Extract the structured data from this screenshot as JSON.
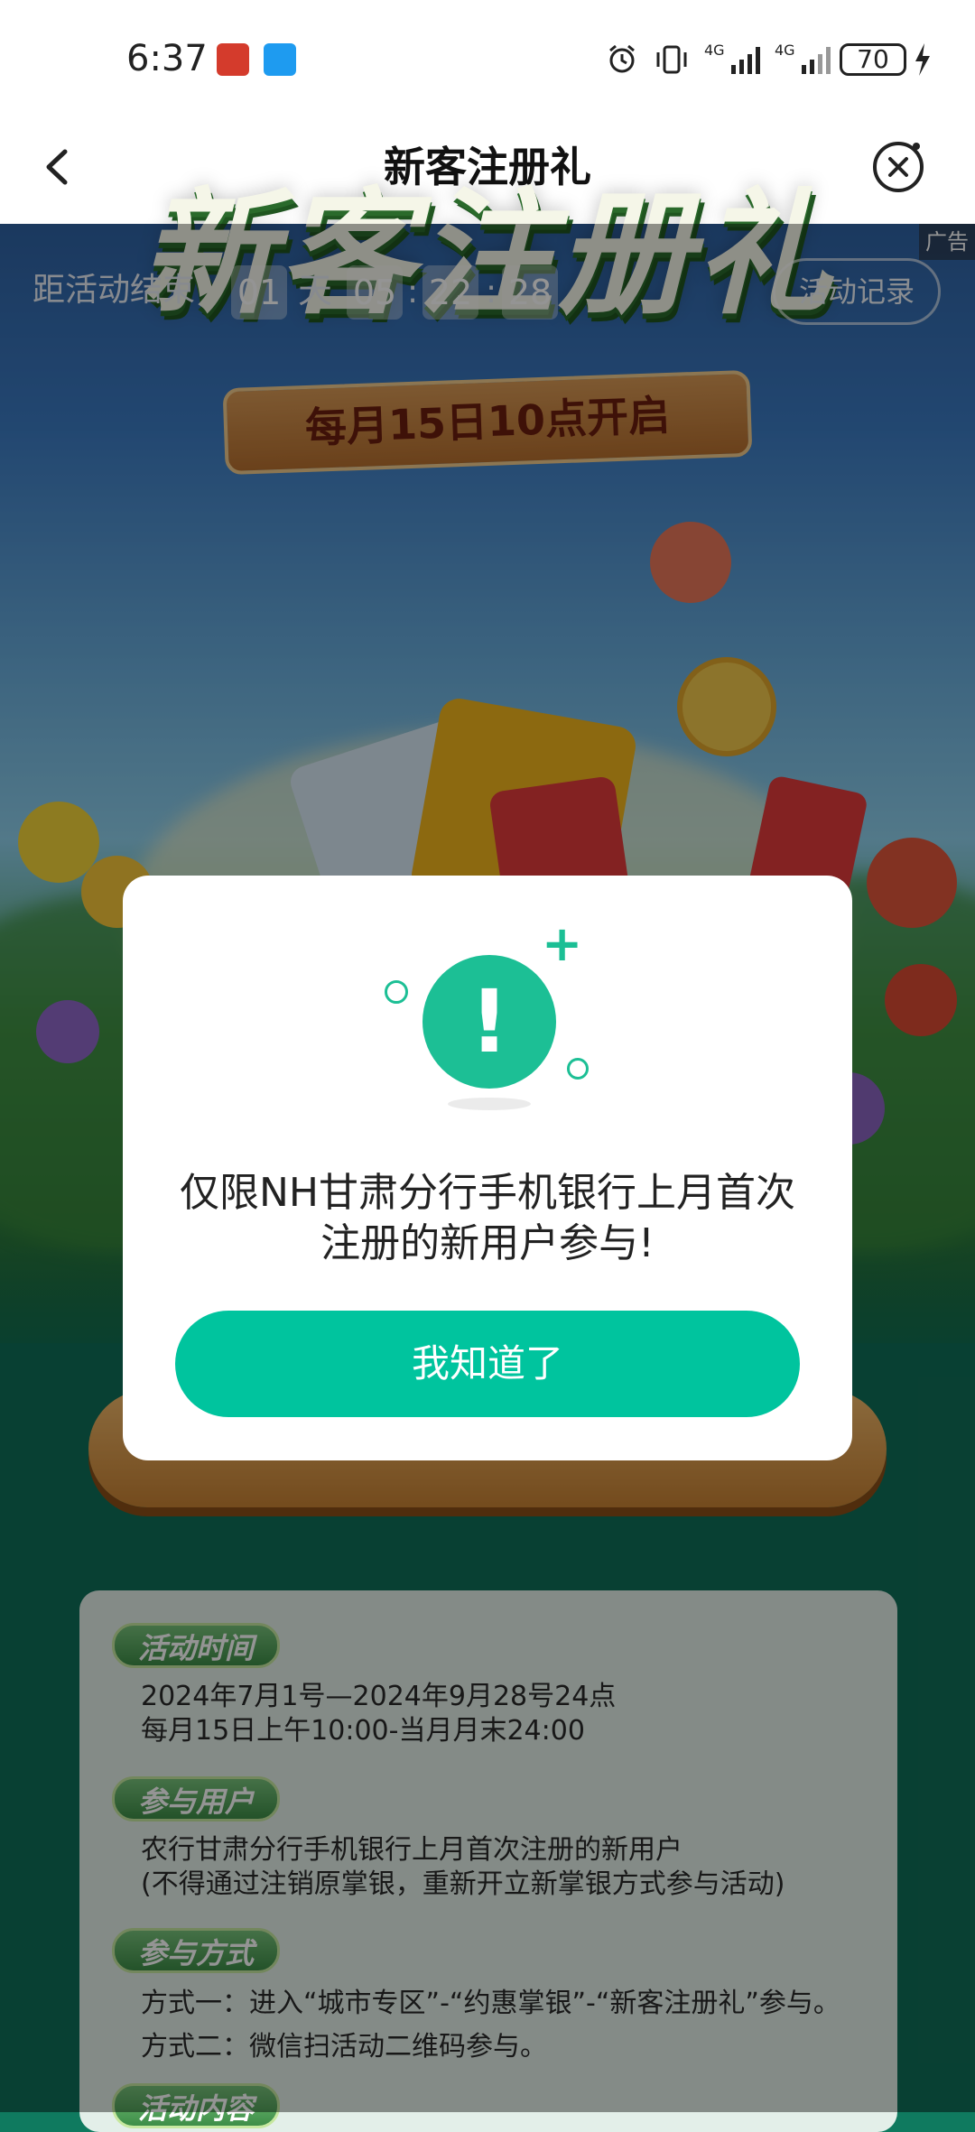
{
  "status_bar": {
    "time": "6:37",
    "battery": "70",
    "network1": "4G",
    "network2": "4G"
  },
  "header": {
    "title": "新客注册礼"
  },
  "hero": {
    "title": "新客注册礼",
    "banner": "每月15日10点开启",
    "countdown_label": "距活动结束",
    "countdown": {
      "days": "01",
      "day_unit": "天",
      "hours": "05",
      "minutes": "22",
      "seconds": "28"
    },
    "records_button": "活动记录",
    "ad_label": "广告"
  },
  "dialog": {
    "message": "仅限NH甘肃分行手机银行上月首次注册的新用户参与!",
    "ok_button": "我知道了"
  },
  "rules": {
    "time_tag": "活动时间",
    "time_lines": [
      "2024年7月1号—2024年9月28号24点",
      "每月15日上午10:00-当月月末24:00"
    ],
    "user_tag": "参与用户",
    "user_lines": [
      "农行甘肃分行手机银行上月首次注册的新用户",
      "(不得通过注销原掌银，重新开立新掌银方式参与活动)"
    ],
    "way_tag": "参与方式",
    "way_lines": [
      "方式一：进入“城市专区”-“约惠掌银”-“新客注册礼”参与。",
      "方式二：微信扫活动二维码参与。"
    ],
    "content_tag": "活动内容"
  },
  "colors": {
    "accent": "#00c49e",
    "dialog_bg": "#ffffff",
    "hero_bottom": "#0f6f58"
  },
  "icons": {
    "back": "chevron-left-icon",
    "close_mini_program": "close-circle-icon",
    "alert": "exclamation-icon"
  }
}
